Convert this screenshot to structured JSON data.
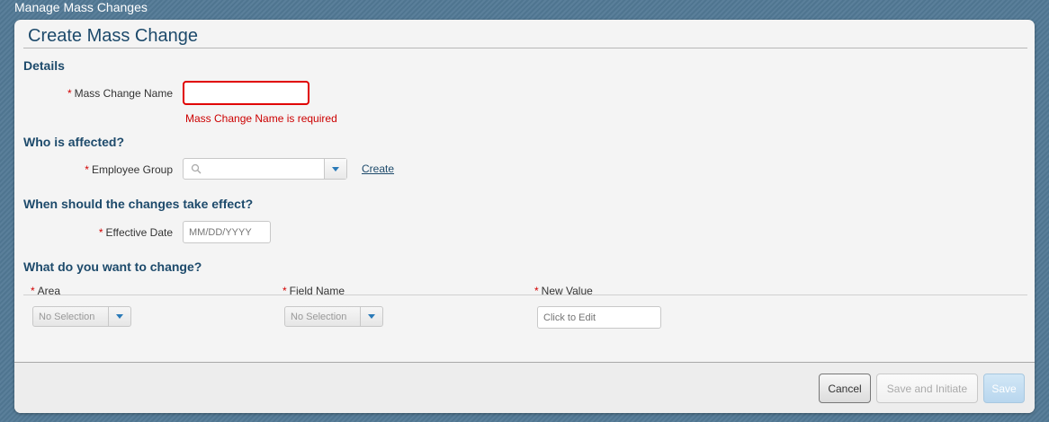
{
  "page": {
    "header": "Manage Mass Changes"
  },
  "dialog": {
    "title": "Create Mass Change",
    "sections": {
      "details": "Details",
      "who": "Who is affected?",
      "when": "When should the changes take effect?",
      "what": "What do you want to change?"
    },
    "required_marker": "*",
    "mass_change_name": {
      "label": "Mass Change Name",
      "value": "",
      "error": "Mass Change Name is required"
    },
    "employee_group": {
      "label": "Employee Group",
      "value": "",
      "create_link": "Create"
    },
    "effective_date": {
      "label": "Effective Date",
      "placeholder": "MM/DD/YYYY"
    },
    "changes_table": {
      "columns": [
        "Area",
        "Field Name",
        "New Value"
      ],
      "row": {
        "area": "No Selection",
        "field_name": "No Selection",
        "new_value_placeholder": "Click to Edit"
      }
    },
    "buttons": {
      "cancel": "Cancel",
      "save_and_initiate": "Save and Initiate",
      "save": "Save"
    }
  },
  "colors": {
    "title": "#1d4a6b",
    "error": "#cc0000",
    "accent": "#2a7ab8"
  }
}
